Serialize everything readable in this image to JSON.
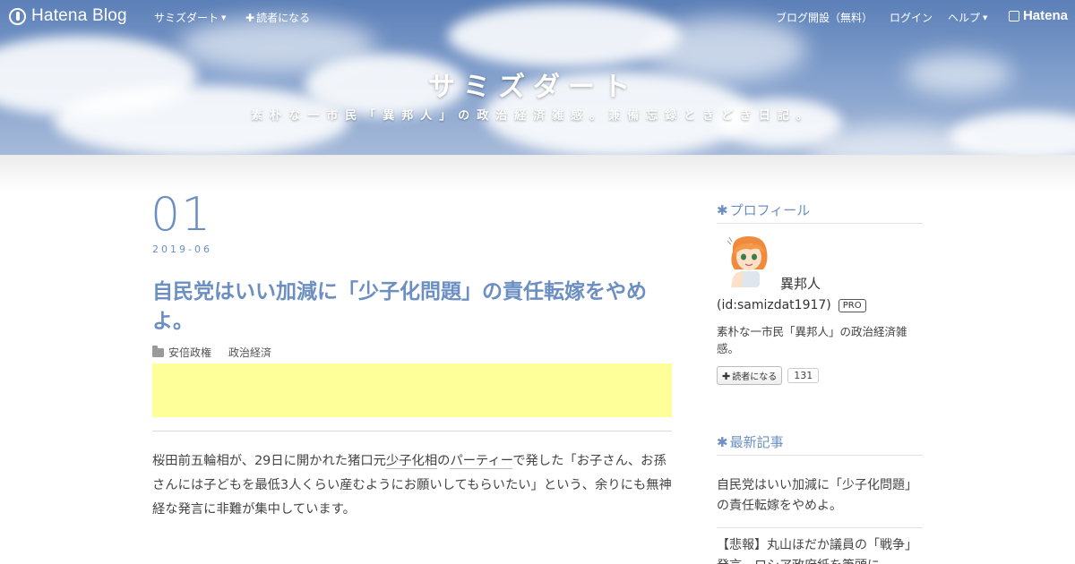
{
  "globalbar": {
    "logo_text": "Hatena Blog",
    "blog_menu": "サミズダート",
    "subscribe": "読者になる",
    "signup": "ブログ開設（無料）",
    "login": "ログイン",
    "help": "ヘルプ",
    "hatena": "Hatena"
  },
  "header": {
    "title": "サミズダート",
    "description": "素朴な一市民「異邦人」の政治経済雑感。兼備忘録ときどき日記。"
  },
  "entry": {
    "day": "01",
    "year_month": "2019-06",
    "title": "自民党はいい加減に「少子化問題」の責任転嫁をやめよ。",
    "categories": [
      "安倍政権",
      "政治経済"
    ],
    "body": {
      "part1": "桜田前五輪相が、29日に開かれた猪口元",
      "keyword": "少子化相",
      "part2": "の",
      "keyword2": "パーティー",
      "part3": "で発した「お子さん、お孫さんには子どもを最低3人くらい産むようにお願いしてもらいたい」という、余りにも無神経な発言に非難が集中しています。"
    }
  },
  "sidebar": {
    "profile": {
      "heading": "プロフィール",
      "name": "異邦人",
      "id": "(id:samizdat1917)",
      "badge": "PRO",
      "description": "素朴な一市民「異邦人」の政治経済雑感。",
      "follow_label": "読者になる",
      "follower_count": "131"
    },
    "recent": {
      "heading": "最新記事",
      "items": [
        "自民党はいい加減に「少子化問題」の責任転嫁をやめよ。",
        "【悲報】丸山ほだか議員の「戦争」発言、ロシア政府紙を筆頭に"
      ]
    }
  },
  "colors": {
    "accent": "#6c8fc2",
    "ad_background": "#ffff99"
  }
}
